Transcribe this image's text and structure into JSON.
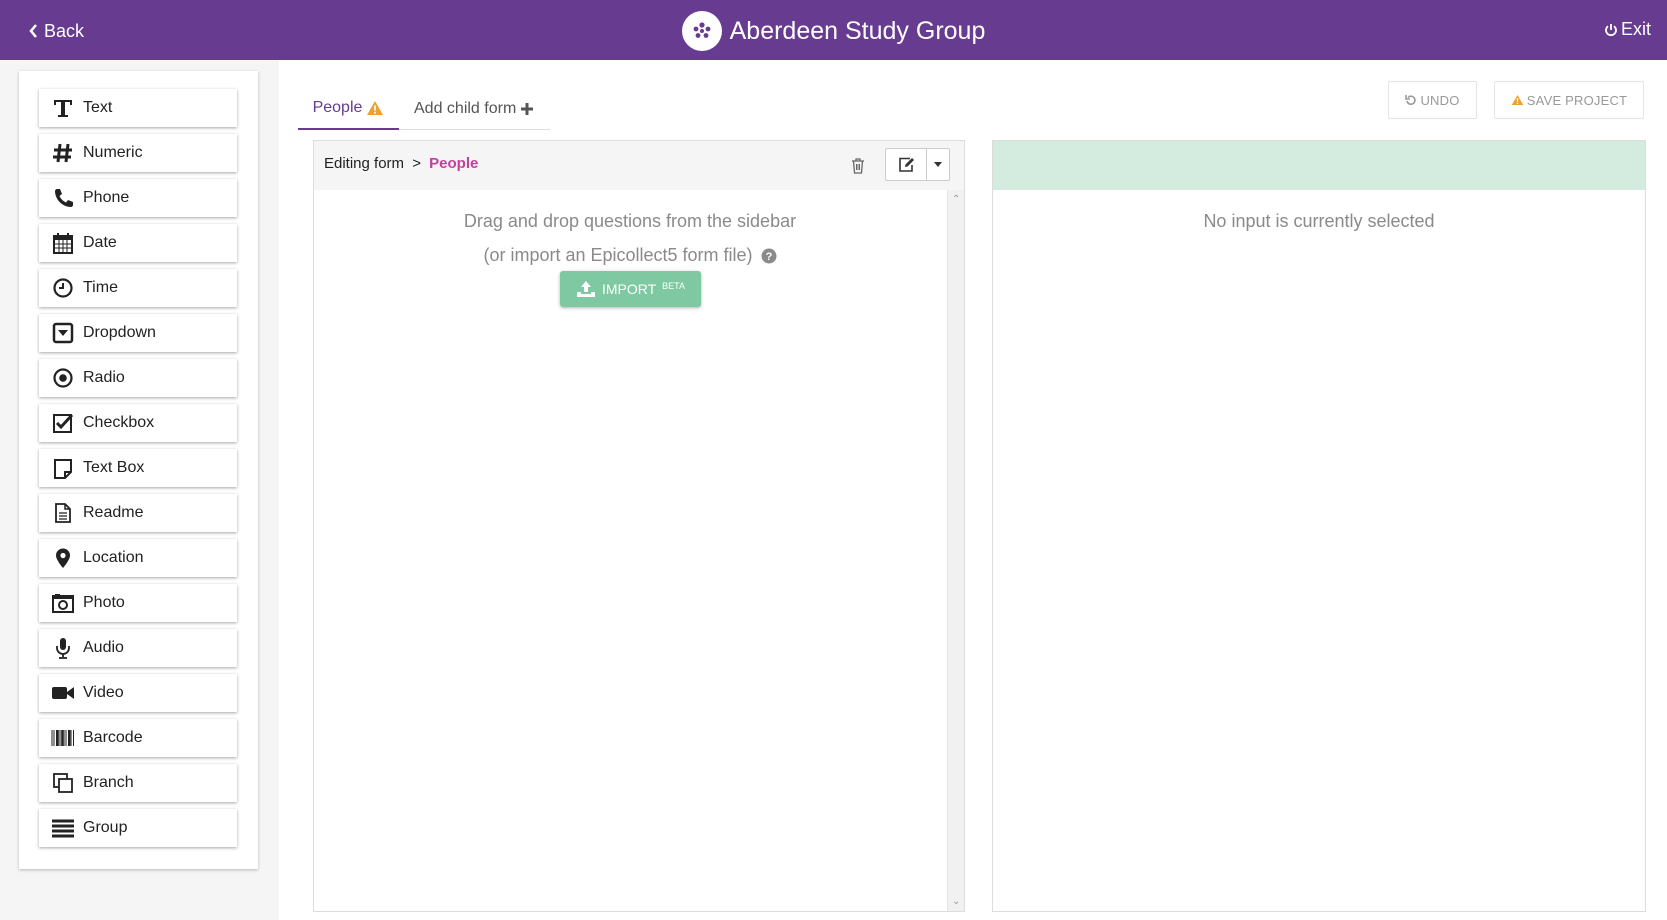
{
  "header": {
    "back_label": "Back",
    "app_title": "Aberdeen Study Group",
    "exit_label": "Exit",
    "bar_color": "#673c90"
  },
  "sidebar": {
    "items": [
      {
        "label": "Text",
        "icon": "text-icon"
      },
      {
        "label": "Numeric",
        "icon": "hash-icon"
      },
      {
        "label": "Phone",
        "icon": "phone-icon"
      },
      {
        "label": "Date",
        "icon": "calendar-icon"
      },
      {
        "label": "Time",
        "icon": "clock-icon"
      },
      {
        "label": "Dropdown",
        "icon": "dropdown-icon"
      },
      {
        "label": "Radio",
        "icon": "radio-icon"
      },
      {
        "label": "Checkbox",
        "icon": "checkbox-icon"
      },
      {
        "label": "Text Box",
        "icon": "textbox-icon"
      },
      {
        "label": "Readme",
        "icon": "document-icon"
      },
      {
        "label": "Location",
        "icon": "location-pin-icon"
      },
      {
        "label": "Photo",
        "icon": "camera-icon"
      },
      {
        "label": "Audio",
        "icon": "microphone-icon"
      },
      {
        "label": "Video",
        "icon": "video-camera-icon"
      },
      {
        "label": "Barcode",
        "icon": "barcode-icon"
      },
      {
        "label": "Branch",
        "icon": "branch-icon"
      },
      {
        "label": "Group",
        "icon": "group-icon"
      }
    ]
  },
  "tabs": {
    "people_label": "People",
    "add_child_label": "Add child form"
  },
  "toolbar": {
    "undo_label": "UNDO",
    "save_label": "SAVE PROJECT"
  },
  "form": {
    "breadcrumb_prefix": "Editing form",
    "breadcrumb_sep": ">",
    "form_name": "People",
    "empty_line1": "Drag and drop questions from the sidebar",
    "empty_line2": "(or import an Epicollect5 form file)",
    "import_label": "IMPORT",
    "import_badge": "BETA"
  },
  "properties": {
    "empty_message": "No input is currently selected",
    "header_color": "#d4ece0"
  }
}
